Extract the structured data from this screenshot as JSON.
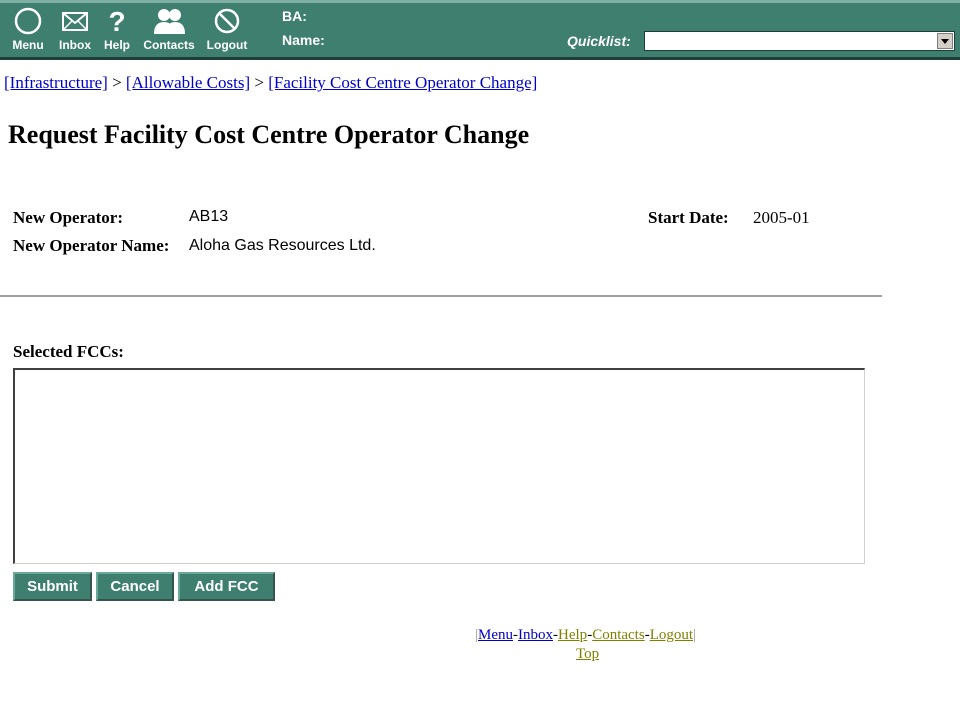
{
  "toolbar": {
    "buttons": [
      {
        "label": "Menu",
        "icon": "compass-icon"
      },
      {
        "label": "Inbox",
        "icon": "envelope-icon"
      },
      {
        "label": "Help",
        "icon": "question-icon"
      },
      {
        "label": "Contacts",
        "icon": "people-icon"
      },
      {
        "label": "Logout",
        "icon": "no-entry-icon"
      }
    ],
    "ba_label": "BA:",
    "name_label": "Name:",
    "quicklist_label": "Quicklist:",
    "quicklist_value": ""
  },
  "breadcrumb": {
    "items": [
      "[Infrastructure]",
      "[Allowable Costs]",
      "[Facility Cost Centre Operator Change]"
    ],
    "separator": ">"
  },
  "page_title": "Request Facility Cost Centre Operator Change",
  "details": {
    "new_operator_label": "New Operator:",
    "new_operator_value": "AB13",
    "new_operator_name_label": "New Operator Name:",
    "new_operator_name_value": "Aloha Gas Resources Ltd.",
    "start_date_label": "Start Date:",
    "start_date_value": "2005-01"
  },
  "selected_fccs_label": "Selected FCCs:",
  "selected_fccs_items": [],
  "actions": {
    "submit": "Submit",
    "cancel": "Cancel",
    "add_fcc": "Add FCC"
  },
  "footer": {
    "links": [
      "Menu",
      "Inbox",
      "Help",
      "Contacts",
      "Logout"
    ],
    "link_separator": "-",
    "bracket_left": "|",
    "bracket_right": "|",
    "top_link": "Top"
  },
  "colors": {
    "toolbar_bg": "#3f7f70",
    "button_bg": "#3f7f70",
    "link_blue": "#0000cc",
    "link_visited": "#808000"
  }
}
